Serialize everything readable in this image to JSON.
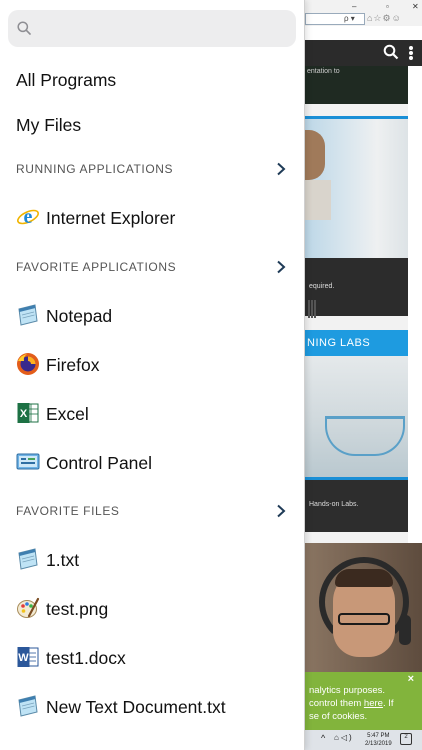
{
  "drawer": {
    "search": {
      "placeholder": "",
      "value": ""
    },
    "top_items": [
      "All Programs",
      "My Files"
    ],
    "sections": {
      "running": {
        "title": "RUNNING APPLICATIONS",
        "items": [
          {
            "label": "Internet Explorer",
            "icon": "internet-explorer-icon"
          }
        ]
      },
      "favorite_apps": {
        "title": "FAVORITE APPLICATIONS",
        "items": [
          {
            "label": "Notepad",
            "icon": "notepad-icon"
          },
          {
            "label": "Firefox",
            "icon": "firefox-icon"
          },
          {
            "label": "Excel",
            "icon": "excel-icon"
          },
          {
            "label": "Control Panel",
            "icon": "control-panel-icon"
          }
        ]
      },
      "favorite_files": {
        "title": "FAVORITE FILES",
        "items": [
          {
            "label": "1.txt",
            "icon": "text-file-icon"
          },
          {
            "label": "test.png",
            "icon": "paint-file-icon"
          },
          {
            "label": "test1.docx",
            "icon": "word-file-icon"
          },
          {
            "label": "New Text Document.txt",
            "icon": "text-file-icon"
          }
        ]
      }
    }
  },
  "background": {
    "page_snippets": {
      "strip1": "entation to",
      "strip2": "equired.",
      "blue_banner": "NING LABS",
      "strip3": "Hands-on Labs."
    },
    "cookie_banner": {
      "line1": "nalytics purposes.",
      "line2_prefix": "control them ",
      "line2_link": "here",
      "line2_suffix": ". If",
      "line3": "se of cookies.",
      "close": "×"
    },
    "taskbar": {
      "time": "5:47 PM",
      "date": "2/13/2019",
      "notifications": "2"
    }
  },
  "colors": {
    "accent_blue": "#1e9be0",
    "cookie_green": "#82b43c",
    "chevron": "#1f3b57"
  }
}
